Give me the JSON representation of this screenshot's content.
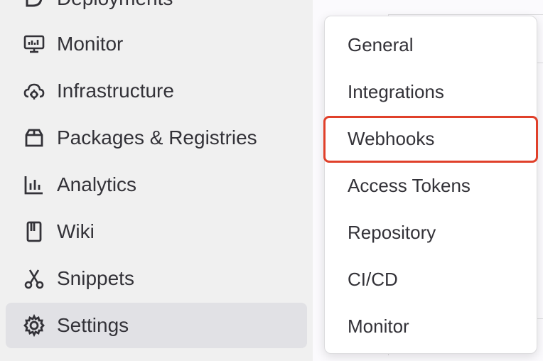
{
  "sidebar": {
    "items": [
      {
        "label": "Deployments",
        "icon": "rocket-icon"
      },
      {
        "label": "Monitor",
        "icon": "monitor-icon"
      },
      {
        "label": "Infrastructure",
        "icon": "cloud-gear-icon"
      },
      {
        "label": "Packages & Registries",
        "icon": "package-icon"
      },
      {
        "label": "Analytics",
        "icon": "chart-icon"
      },
      {
        "label": "Wiki",
        "icon": "book-icon"
      },
      {
        "label": "Snippets",
        "icon": "scissors-icon"
      },
      {
        "label": "Settings",
        "icon": "gear-icon",
        "active": true
      }
    ]
  },
  "dropdown": {
    "items": [
      {
        "label": "General"
      },
      {
        "label": "Integrations"
      },
      {
        "label": "Webhooks",
        "highlighted": true
      },
      {
        "label": "Access Tokens"
      },
      {
        "label": "Repository"
      },
      {
        "label": "CI/CD"
      },
      {
        "label": "Monitor"
      }
    ]
  },
  "colors": {
    "sidebar_bg": "#f0f0f0",
    "active_bg": "#e1e1e5",
    "highlight_border": "#e0402a",
    "text": "#333238"
  }
}
